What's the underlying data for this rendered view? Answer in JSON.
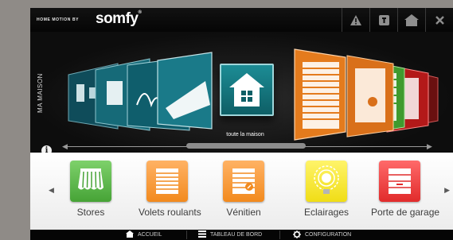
{
  "header": {
    "brand_small": "HOME MOTION BY",
    "brand_logo": "somfy",
    "brand_reg": "®",
    "icons": [
      "warning-icon",
      "remote-icon",
      "home-icon",
      "close-icon"
    ]
  },
  "carousel": {
    "side_label": "MA MAISON",
    "home_label": "toute la maison",
    "arrow_left": "◀",
    "arrow_right": "▶"
  },
  "info_label": "i",
  "categories": {
    "nav_left": "◀",
    "nav_right": "▶",
    "items": [
      {
        "label": "Stores",
        "color": "#5dbb4a"
      },
      {
        "label": "Volets roulants",
        "color": "#f7962e"
      },
      {
        "label": "Vénitien",
        "color": "#f7962e"
      },
      {
        "label": "Eclairages",
        "color": "#f5e52a"
      },
      {
        "label": "Porte de garage",
        "color": "#ee3b3b"
      }
    ]
  },
  "footer": {
    "accueil": "ACCUEIL",
    "tableau": "TABLEAU DE BORD",
    "configuration": "CONFIGURATION"
  }
}
